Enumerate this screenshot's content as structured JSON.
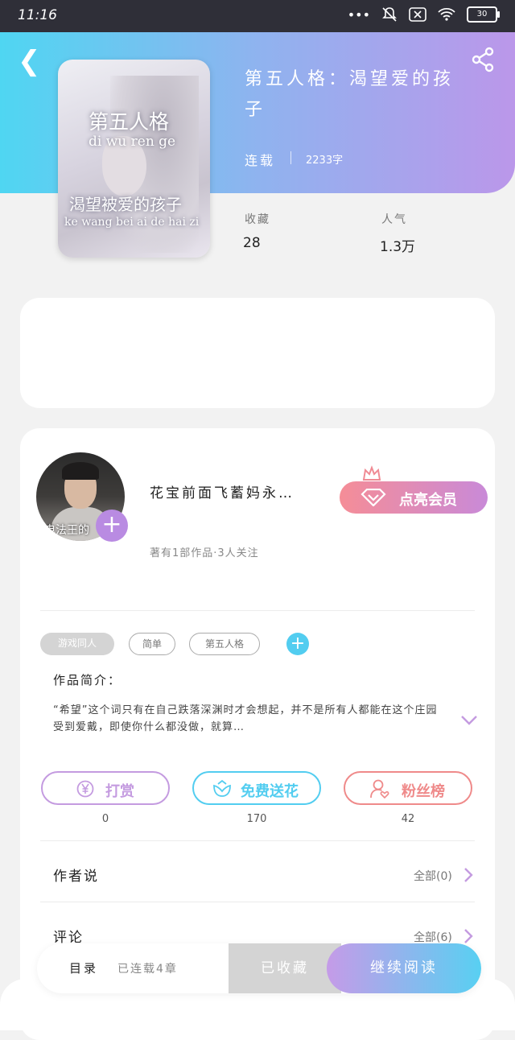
{
  "status_bar": {
    "time": "11:16",
    "battery": "30"
  },
  "cover": {
    "title_cn": "第五人格",
    "title_pinyin": "di wu ren ge",
    "subtitle_cn": "渴望被爱的孩子",
    "subtitle_pinyin": "ke wang bei ai de hai zi"
  },
  "book": {
    "title": "第五人格：渴望爱的孩子",
    "status": "连载",
    "word_count": "2233字"
  },
  "stats": [
    {
      "label": "收藏",
      "value": "28"
    },
    {
      "label": "人气",
      "value": "1.3万"
    }
  ],
  "author": {
    "avatar_text": "电法王的",
    "name": "花宝前面飞蓄妈永…",
    "meta": "著有1部作品·3人关注",
    "vip_button": "点亮会员"
  },
  "tags": [
    "游戏同人",
    "简单",
    "第五人格"
  ],
  "intro": {
    "title": "作品简介：",
    "text": "“希望”这个词只有在自己跌落深渊时才会想起，并不是所有人都能在这个庄园受到爱戴，即使你什么都没做，就算…"
  },
  "actions": [
    {
      "label": "打赏",
      "count": "0",
      "icon": "yen-icon",
      "color": "#c49be0"
    },
    {
      "label": "免费送花",
      "count": "170",
      "icon": "flower-icon",
      "color": "#52cdf0"
    },
    {
      "label": "粉丝榜",
      "count": "42",
      "icon": "user-heart-icon",
      "color": "#ef8a8a"
    }
  ],
  "rows": [
    {
      "label": "作者说",
      "right": "全部(0)"
    },
    {
      "label": "评论",
      "right": "全部(6)"
    }
  ],
  "bottom_bar": {
    "catalog": "目录",
    "chapters": "已连载4章",
    "collected": "已收藏",
    "read": "继续阅读"
  },
  "colors": {
    "accent_purple": "#b98be2",
    "accent_cyan": "#52cdf0"
  }
}
